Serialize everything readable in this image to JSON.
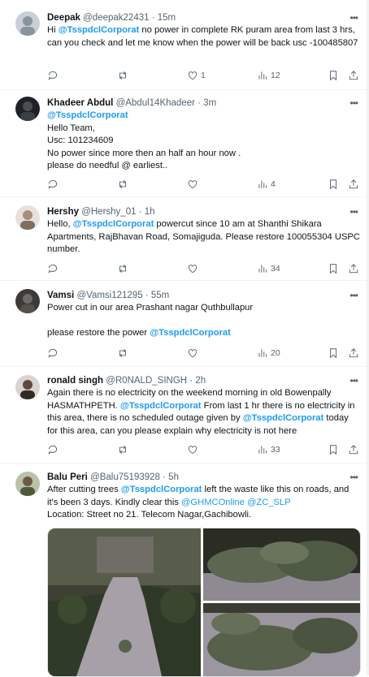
{
  "tweets": [
    {
      "name": "Deepak",
      "handle": "@deepak22431",
      "time": "15m",
      "text_pre": "Hi ",
      "mention1": "@TsspdclCorporat",
      "text_post": " no power in complete RK puram area from last 3 hrs, can you check and let me know when the power will be back usc -100485807",
      "likes": "1",
      "views": "12"
    },
    {
      "name": "Khadeer Abdul",
      "handle": "@Abdul14Khadeer",
      "time": "3m",
      "mention1": "@TsspdclCorporat",
      "line1": "Hello Team,",
      "line2": "Usc: 101234609",
      "line3": "No power since more then an half an hour now .",
      "line4": "please do needful @ earliest..",
      "views": "4"
    },
    {
      "name": "Hershy",
      "handle": "@Hershy_01",
      "time": "1h",
      "text_pre": "Hello, ",
      "mention1": "@TsspdclCorporat",
      "text_post": " powercut  since 10 am at Shanthi Shikara Apartments, RajBhavan Road, Somajiguda. Please restore 100055304 USPC number.",
      "views": "34"
    },
    {
      "name": "Vamsi",
      "handle": "@Vamsi121295",
      "time": "55m",
      "line1": "Power cut in our area Prashant nagar Quthbullapur",
      "text_pre": "please restore the power ",
      "mention1": "@TsspdclCorporat",
      "views": "20"
    },
    {
      "name": "ronald singh",
      "handle": "@R0NALD_SINGH",
      "time": "2h",
      "text_pre": "Again there is no electricity on the weekend morning in old Bowenpally HASMATHPETH. ",
      "mention1": "@TsspdclCorporat",
      "text_mid": " From last 1 hr there is no electricity in this area, there is no scheduled outage given by ",
      "mention2": "@TsspdclCorporat",
      "text_post": " today for this area, can you please explain why electricity is not here",
      "views": "33"
    },
    {
      "name": "Balu Peri",
      "handle": "@Balu75193928",
      "time": "5h",
      "text_pre": "After cutting trees ",
      "mention1": "@TsspdclCorporat",
      "text_mid": " left the waste like this on roads, and it's been 3 days. Kindly clear this ",
      "mention2": "@GHMCOnline",
      "mention3": "@ZC_SLP",
      "line_loc": "Location: Street no 21. Telecom Nagar,Gachibowli."
    }
  ],
  "ui": {
    "dot": "·",
    "more": "•••"
  },
  "colors": {
    "link": "#1d9bf0",
    "muted": "#536471",
    "text": "#0f1419",
    "divider": "#eff3f4"
  },
  "icons": [
    "reply-icon",
    "retweet-icon",
    "like-icon",
    "views-icon",
    "bookmark-icon",
    "share-icon",
    "more-icon"
  ]
}
